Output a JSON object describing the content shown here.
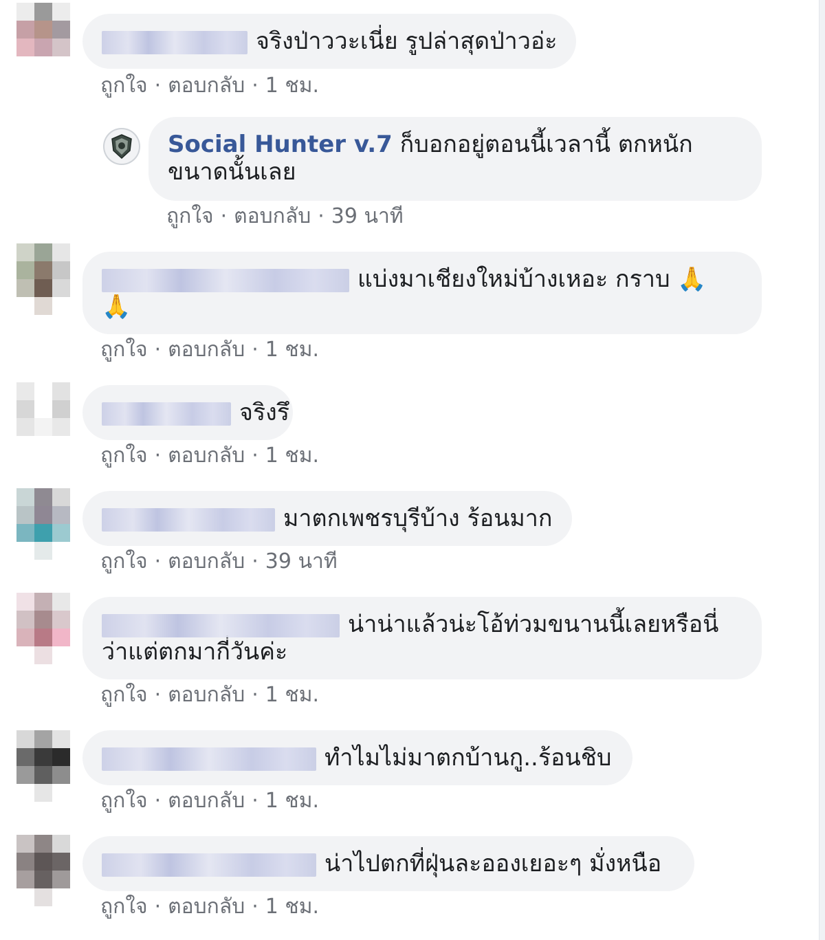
{
  "actions": {
    "like": "ถูกใจ",
    "reply": "ตอบกลับ",
    "separator": "·"
  },
  "comments": [
    {
      "text": "จริงป่าววะเนี่ย รูปล่าสุดป่าวอ่ะ",
      "time": "1 ชม."
    },
    {
      "author": "Social Hunter v.7",
      "text": "ก็บอกอยู่ตอนนี้เวลานี้ ตกหนัก",
      "text2": "ขนาดนั้นเลย",
      "time": "39 นาที"
    },
    {
      "text": "แบ่งมาเชียงใหม่บ้างเหอะ กราบ 🙏",
      "text2": "🙏",
      "time": "1 ชม."
    },
    {
      "text": "จริงรึ",
      "time": "1 ชม."
    },
    {
      "text": "มาตกเพชรบุรีบ้าง ร้อนมาก",
      "time": "39 นาที"
    },
    {
      "text": "น่าน่าแล้วน่ะโอ้ท่วมขนานนี้เลยหรือนี่",
      "text2": "ว่าแต่ตกมากี่วันค่ะ",
      "time": "1 ชม."
    },
    {
      "text": "ทำไมไม่มาตกบ้านกู..ร้อนชิบ",
      "time": "1 ชม."
    },
    {
      "text": "น่าไปตกที่ฝุ่นละอองเยอะๆ มั่งหนือ",
      "time": "1 ชม."
    }
  ]
}
